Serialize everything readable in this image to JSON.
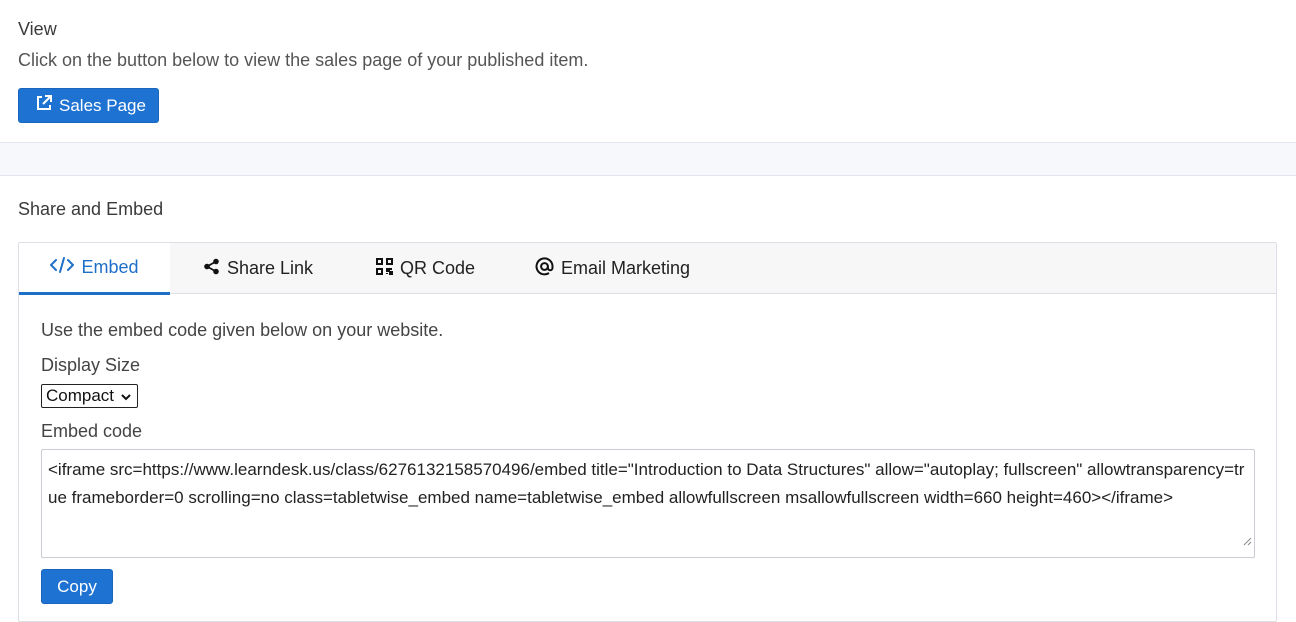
{
  "view": {
    "title": "View",
    "description": "Click on the button below to view the sales page of your published item.",
    "sales_button_label": "Sales Page"
  },
  "share": {
    "title": "Share and Embed",
    "tabs": [
      {
        "label": "Embed",
        "icon": "code-icon",
        "active": true
      },
      {
        "label": "Share Link",
        "icon": "share-nodes-icon",
        "active": false
      },
      {
        "label": "QR Code",
        "icon": "qr-code-icon",
        "active": false
      },
      {
        "label": "Email Marketing",
        "icon": "at-sign-icon",
        "active": false
      }
    ]
  },
  "embed": {
    "description": "Use the embed code given below on your website.",
    "display_size_label": "Display Size",
    "display_size_value": "Compact",
    "code_label": "Embed code",
    "code_value": "<iframe src=https://www.learndesk.us/class/6276132158570496/embed title=\"Introduction to Data Structures\" allow=\"autoplay; fullscreen\" allowtransparency=true frameborder=0 scrolling=no class=tabletwise_embed name=tabletwise_embed allowfullscreen msallowfullscreen width=660 height=460></iframe>",
    "copy_button_label": "Copy"
  },
  "colors": {
    "primary": "#1e73d2",
    "active_tab": "#1e6fc8",
    "band": "#f7f8fb"
  }
}
